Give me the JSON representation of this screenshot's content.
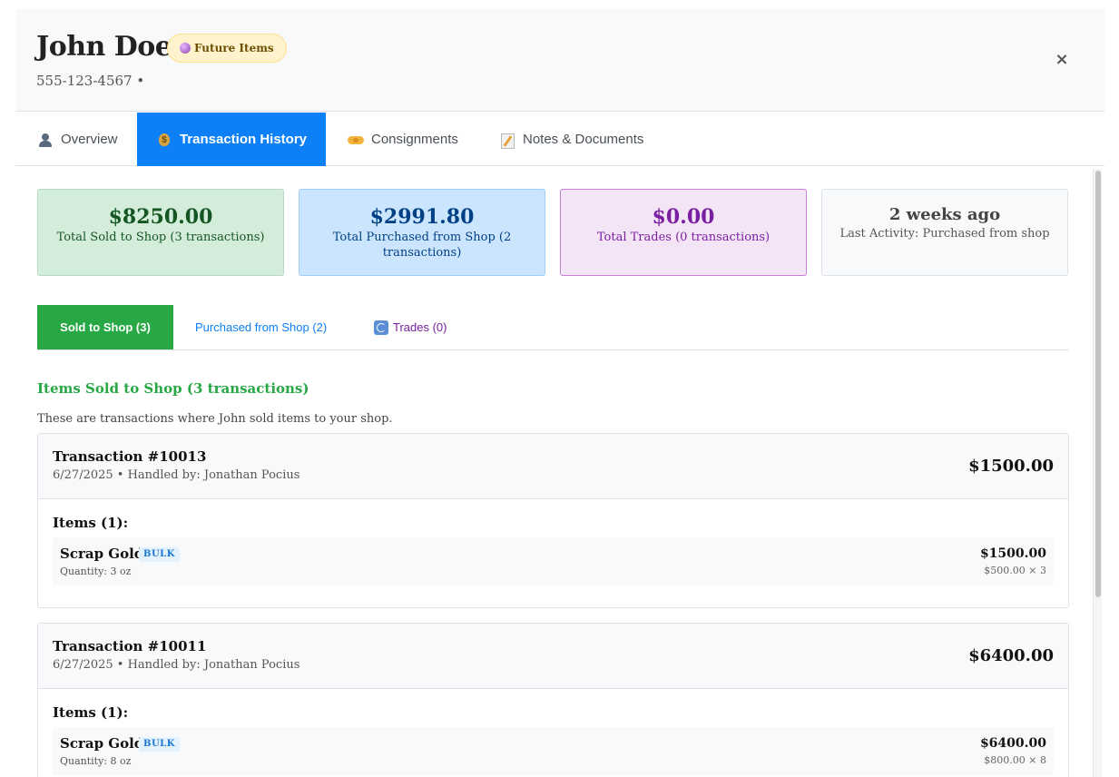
{
  "customer": {
    "name": "John Doe",
    "badge": "Future Items",
    "badge_icon": "crystal-ball-icon",
    "phone": "555-123-4567 •",
    "close_symbol": "×"
  },
  "tabs": [
    {
      "label": "Overview",
      "icon": "person-icon",
      "active": false
    },
    {
      "label": "Transaction History",
      "icon": "money-bag-icon",
      "active": true
    },
    {
      "label": "Consignments",
      "icon": "handshake-icon",
      "active": false
    },
    {
      "label": "Notes & Documents",
      "icon": "memo-icon",
      "active": false
    }
  ],
  "stats": {
    "sold": {
      "value": "$8250.00",
      "label": "Total Sold to Shop (3 transactions)",
      "color": "#155724"
    },
    "purchased": {
      "value": "$2991.80",
      "label": "Total Purchased from Shop (2 transactions)",
      "color": "#004085"
    },
    "trades": {
      "value": "$0.00",
      "label": "Total Trades (0 transactions)",
      "color": "#7b1fa2"
    },
    "last_activity": {
      "value": "2 weeks ago",
      "label": "Last Activity: Purchased from shop"
    }
  },
  "subtabs": [
    {
      "label": "Sold to Shop (3)",
      "active": true,
      "color": "#28a745"
    },
    {
      "label": "Purchased from Shop (2)",
      "active": false,
      "color": "#0d7ff7"
    },
    {
      "label": "Trades (0)",
      "active": false,
      "icon": "sync-icon",
      "color": "#7b1fa2"
    }
  ],
  "section": {
    "title": "Items Sold to Shop (3 transactions)",
    "description": "These are transactions where John sold items to your shop."
  },
  "transactions": [
    {
      "id": "Transaction #10013",
      "meta": "6/27/2025 • Handled by: Jonathan Pocius",
      "total": "$1500.00",
      "items_label": "Items (1):",
      "items": [
        {
          "name": "Scrap Gold",
          "badge": "BULK",
          "quantity": "Quantity: 3 oz",
          "price": "$1500.00",
          "calc": "$500.00 × 3"
        }
      ]
    },
    {
      "id": "Transaction #10011",
      "meta": "6/27/2025 • Handled by: Jonathan Pocius",
      "total": "$6400.00",
      "items_label": "Items (1):",
      "items": [
        {
          "name": "Scrap Gold",
          "badge": "BULK",
          "quantity": "Quantity: 8 oz",
          "price": "$6400.00",
          "calc": "$800.00 × 8"
        }
      ]
    }
  ]
}
